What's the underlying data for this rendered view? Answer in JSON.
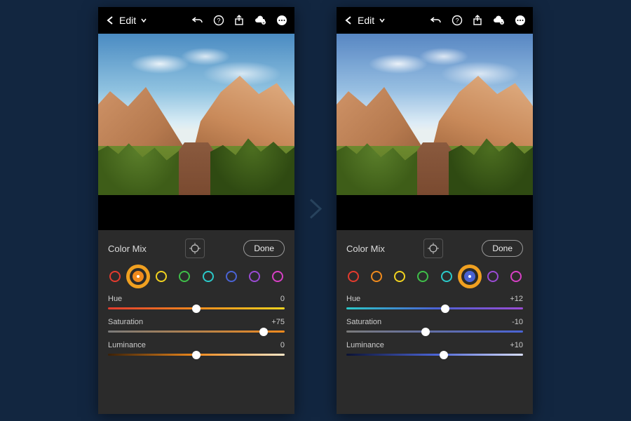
{
  "left": {
    "header": {
      "edit": "Edit"
    },
    "panel_title": "Color Mix",
    "done_label": "Done",
    "swatches": [
      "#e33b2e",
      "#f08a1d",
      "#f2d31f",
      "#3fbf49",
      "#2bc9c9",
      "#4a63d4",
      "#9a4bd4",
      "#d740c5"
    ],
    "selected_swatch_index": 1,
    "sliders": {
      "hue": {
        "label": "Hue",
        "value": "0",
        "pos": 50,
        "gradient": "linear-gradient(to right,#e33b2e,#f08a1d,#f2d31f)"
      },
      "saturation": {
        "label": "Saturation",
        "value": "+75",
        "pos": 88,
        "gradient": "linear-gradient(to right,#7a7a7a,#f08a1d)"
      },
      "luminance": {
        "label": "Luminance",
        "value": "0",
        "pos": 50,
        "gradient": "linear-gradient(to right,#3a2007,#f08a1d,#ffe8c8)"
      }
    }
  },
  "right": {
    "header": {
      "edit": "Edit"
    },
    "panel_title": "Color Mix",
    "done_label": "Done",
    "swatches": [
      "#e33b2e",
      "#f08a1d",
      "#f2d31f",
      "#3fbf49",
      "#2bc9c9",
      "#4a63d4",
      "#9a4bd4",
      "#d740c5"
    ],
    "selected_swatch_index": 5,
    "sliders": {
      "hue": {
        "label": "Hue",
        "value": "+12",
        "pos": 56,
        "gradient": "linear-gradient(to right,#2bc9c9,#4a63d4,#9a4bd4)"
      },
      "saturation": {
        "label": "Saturation",
        "value": "-10",
        "pos": 45,
        "gradient": "linear-gradient(to right,#7a7a7a,#4a63d4)"
      },
      "luminance": {
        "label": "Luminance",
        "value": "+10",
        "pos": 55,
        "gradient": "linear-gradient(to right,#0b1233,#4a63d4,#d8defc)"
      }
    }
  }
}
